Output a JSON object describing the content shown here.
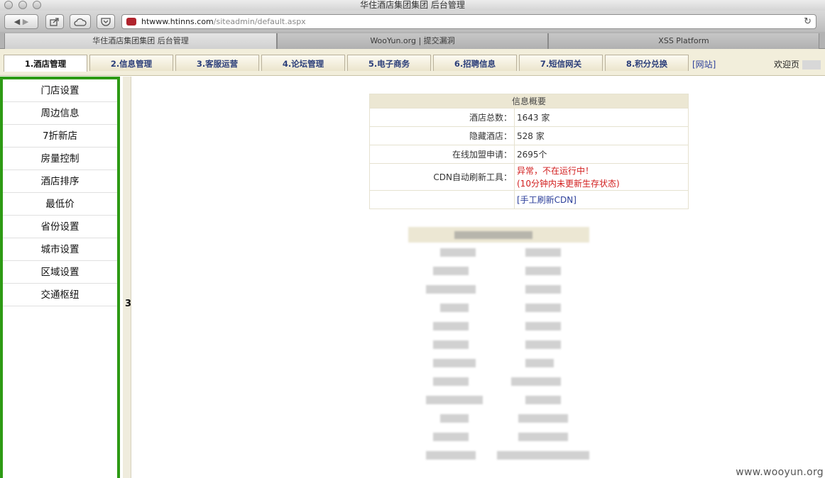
{
  "window": {
    "title": "华住酒店集团集团 后台管理"
  },
  "browser": {
    "url_host": "htwww.htinns.com",
    "url_path": "/siteadmin/default.aspx",
    "tabs": [
      "华住酒店集团集团 后台管理",
      "WooYun.org | 提交漏洞",
      "XSS Platform"
    ],
    "icons": [
      "back-icon",
      "forward-icon",
      "share-icon",
      "cloud-icon",
      "pocket-icon",
      "reload-icon"
    ]
  },
  "nav": {
    "tabs": [
      "1.酒店管理",
      "2.信息管理",
      "3.客服运营",
      "4.论坛管理",
      "5.电子商务",
      "6.招聘信息",
      "7.短信网关",
      "8.积分兑换"
    ],
    "site_link": "[网站]",
    "welcome": "欢迎页"
  },
  "sidebar": {
    "items": [
      "门店设置",
      "周边信息",
      "7折新店",
      "房量控制",
      "酒店排序",
      "最低价",
      "省份设置",
      "城市设置",
      "区域设置",
      "交通枢纽"
    ]
  },
  "divider_toggle": "3",
  "summary": {
    "title": "信息概要",
    "rows": [
      {
        "label": "酒店总数：",
        "value": "1643 家"
      },
      {
        "label": "隐藏酒店：",
        "value": "528 家"
      },
      {
        "label": "在线加盟申请：",
        "value": "2695个"
      }
    ],
    "cdn_label": "CDN自动刷新工具：",
    "cdn_status_line1": "异常，不在运行中！",
    "cdn_status_line2": "(10分钟内未更新生存状态)",
    "cdn_manual": "[手工刷新CDN]",
    "colors": {
      "alert": "#d21e1e",
      "link": "#2c3f9a",
      "header_bg": "#ece7d3",
      "sidebar_border": "#2d9a14"
    }
  },
  "watermark": "www.wooyun.org"
}
